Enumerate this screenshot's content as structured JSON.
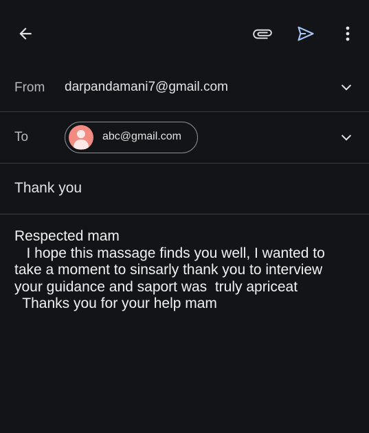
{
  "toolbar": {
    "back_icon": "arrow-left-icon",
    "attach_icon": "paperclip-icon",
    "send_icon": "send-icon",
    "more_icon": "more-vert-icon",
    "send_color": "#a8c7fa"
  },
  "from": {
    "label": "From",
    "email": "darpandamani7@gmail.com"
  },
  "to": {
    "label": "To",
    "recipient": "abc@gmail.com",
    "avatar_color": "#f28b82"
  },
  "subject": "Thank you",
  "body": "Respected mam\n   I hope this massage finds you well, I wanted to\ntake a moment to sinsarly thank you to interview\nyour guidance and saport was  truly apriceat\n  Thanks you for your help mam"
}
